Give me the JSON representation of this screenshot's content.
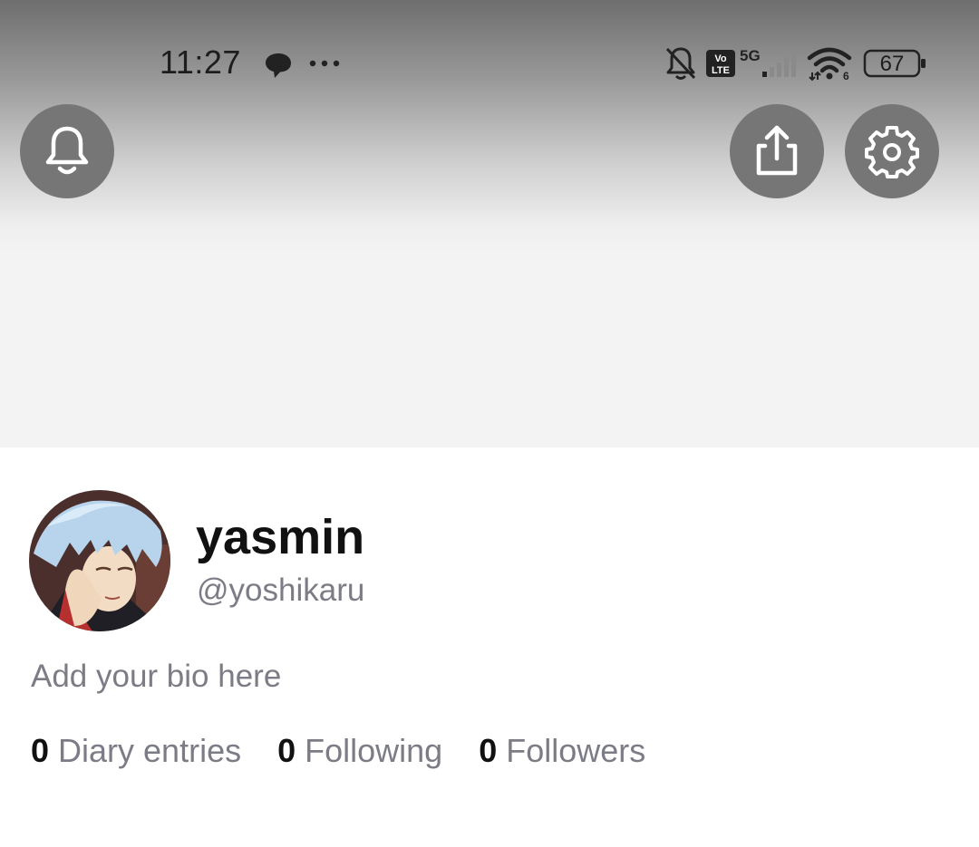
{
  "status_bar": {
    "time": "11:27",
    "icons": [
      "chat-bubble-icon",
      "more-dots-icon",
      "bell-off-icon",
      "volte-icon",
      "signal-5g-icon",
      "wifi-icon"
    ],
    "network": "5G",
    "volte": "Vo LTE",
    "wifi_badge": "6",
    "battery": "67"
  },
  "header": {
    "buttons": [
      "notifications-button",
      "share-button",
      "settings-button"
    ]
  },
  "profile": {
    "display_name": "yasmin",
    "handle": "@yoshikaru",
    "bio_placeholder": "Add your bio here",
    "stats": [
      {
        "count": "0",
        "label": "Diary entries"
      },
      {
        "count": "0",
        "label": "Following"
      },
      {
        "count": "0",
        "label": "Followers"
      }
    ]
  },
  "colors": {
    "button_bg": "#767676",
    "secondary_text": "#7c7c86",
    "primary_text": "#111111"
  }
}
